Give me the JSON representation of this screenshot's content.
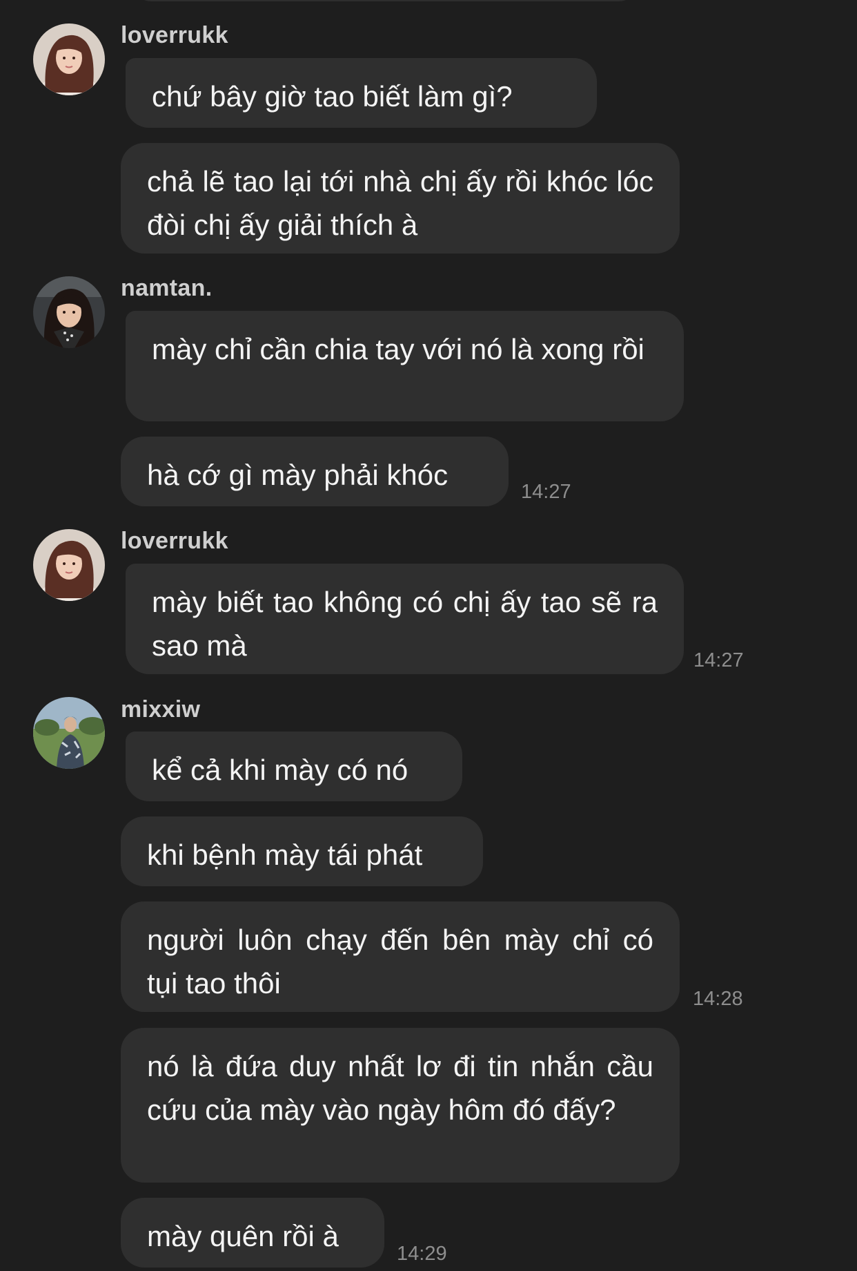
{
  "colors": {
    "background": "#1e1e1e",
    "bubble": "#2f2f2f",
    "sender_name": "#cfcfcf",
    "timestamp": "#8e8e8e"
  },
  "messages": [
    {
      "sender": "loverrukk",
      "bubbles": [
        "chứ bây giờ tao biết làm gì?",
        "chả lẽ tao lại tới nhà chị ấy rồi khóc lóc đòi chị ấy giải thích à"
      ],
      "time": ""
    },
    {
      "sender": "namtan.",
      "bubbles": [
        "mày chỉ cần chia tay với nó là xong rồi",
        "hà cớ gì mày phải khóc"
      ],
      "time": "14:27"
    },
    {
      "sender": "loverrukk",
      "bubbles": [
        "mày biết tao không có chị ấy tao sẽ ra sao mà"
      ],
      "time": "14:27"
    },
    {
      "sender": "mixxiw",
      "bubbles": [
        "kể cả khi mày có nó",
        "khi bệnh mày tái phát",
        "người luôn chạy đến bên mày chỉ có tụi tao thôi",
        "nó là đứa duy nhất lơ đi tin nhắn cầu cứu của mày vào ngày hôm đó đấy?",
        "mày quên rồi à"
      ],
      "time_after_bubble_3": "14:28",
      "time": "14:29"
    }
  ]
}
